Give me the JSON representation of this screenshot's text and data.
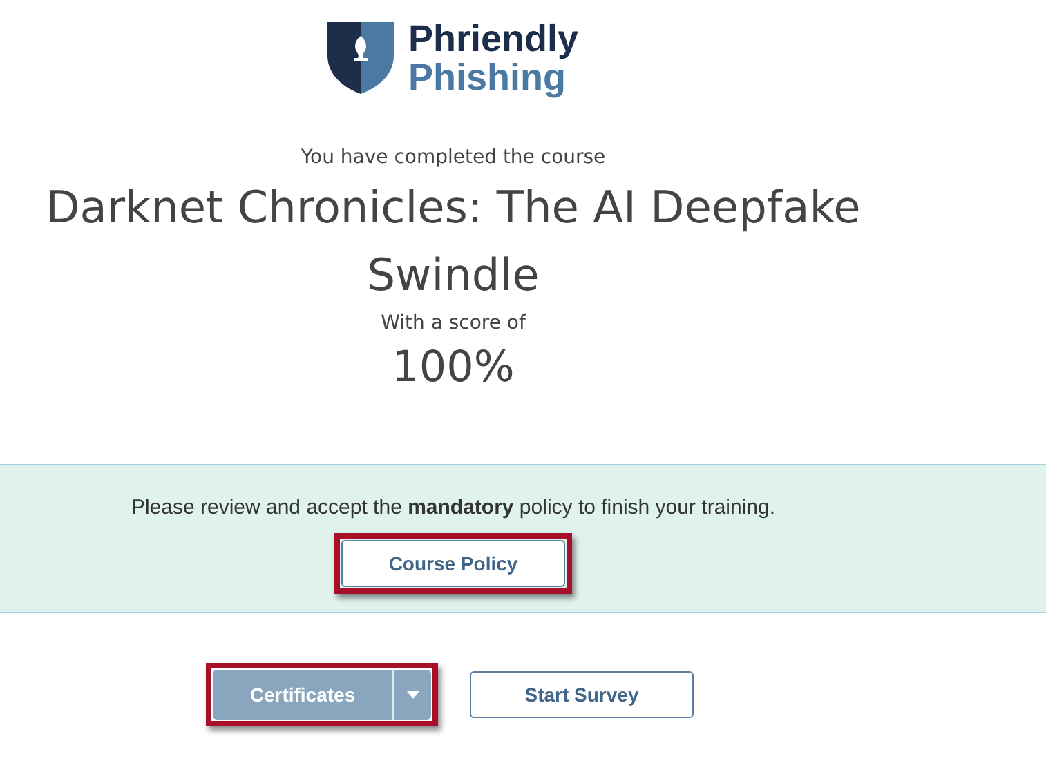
{
  "logo": {
    "line_1": "Phriendly",
    "line_2": "Phishing"
  },
  "completion": {
    "intro": "You have completed the course",
    "course_title": "Darknet Chronicles: The AI Deepfake Swindle",
    "score_label": "With a score of",
    "score": "100%"
  },
  "policy_banner": {
    "message": "Please review and accept the **mandatory** policy to finish your training.",
    "button": {
      "label": "Course Policy",
      "highlighted": true
    }
  },
  "actions": [
    {
      "kind": "split",
      "label": "Certificates",
      "highlighted": true
    },
    {
      "kind": "outline",
      "label": "Start Survey",
      "highlighted": false
    }
  ]
}
